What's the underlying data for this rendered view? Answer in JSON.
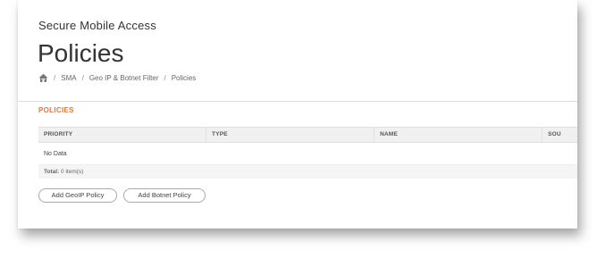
{
  "header": {
    "app_title": "Secure Mobile Access",
    "page_title": "Policies"
  },
  "breadcrumb": {
    "home_icon": "home-icon",
    "separator": "/",
    "items": [
      "SMA",
      "Geo IP & Botnet Filter",
      "Policies"
    ]
  },
  "section": {
    "title": "POLICIES",
    "title_color": "#e8762c"
  },
  "table": {
    "columns": [
      "PRIORITY",
      "TYPE",
      "NAME",
      "SOU"
    ],
    "empty_text": "No Data",
    "total_label": "Total:",
    "total_value": "0 item(s)"
  },
  "actions": {
    "add_geoip": "Add GeoIP Policy",
    "add_botnet": "Add Botnet Policy"
  }
}
